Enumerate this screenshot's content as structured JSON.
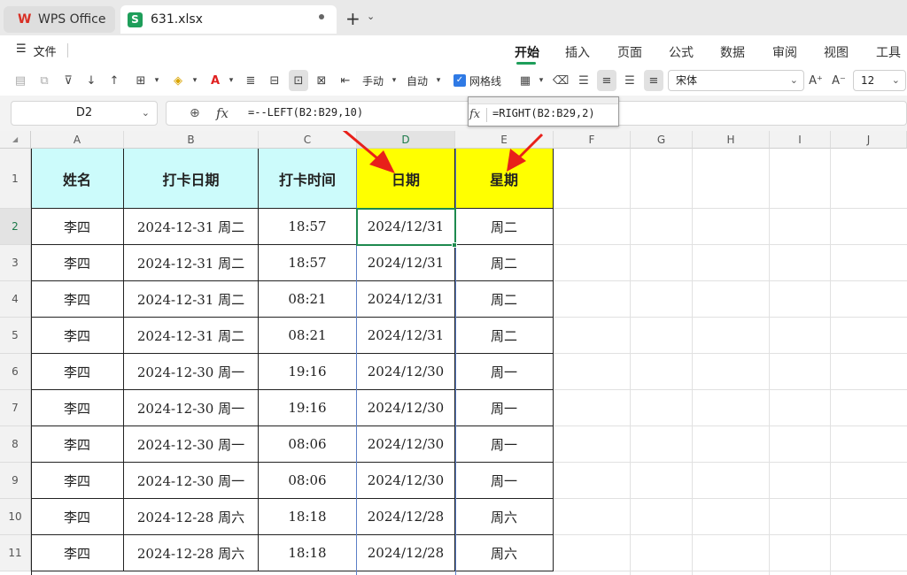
{
  "titlebar": {
    "app_tab": "WPS Office",
    "doc_tab": "631.xlsx",
    "doc_icon_letter": "S",
    "new_tab": "+",
    "new_tab_menu": "⌄"
  },
  "menu": {
    "file_icon": "☰",
    "file": "文件",
    "tabs": [
      "开始",
      "插入",
      "页面",
      "公式",
      "数据",
      "审阅",
      "视图",
      "工具"
    ],
    "active_tab": "开始"
  },
  "toolbar": {
    "manual": "手动",
    "auto": "自动",
    "gridlines": "网格线",
    "gridlines_checked": true,
    "font_name": "宋体",
    "font_size": "12",
    "increase_font": "A⁺",
    "decrease_font": "A⁻"
  },
  "formula_bar": {
    "name_box": "D2",
    "formula": "=--LEFT(B2:B29,10)",
    "fx": "fx"
  },
  "popup": {
    "fx": "fx",
    "formula": "=RIGHT(B2:B29,2)"
  },
  "grid": {
    "columns": [
      "A",
      "B",
      "C",
      "D",
      "E",
      "F",
      "G",
      "H",
      "I",
      "J"
    ],
    "selected_column": "D",
    "selected_row": "2",
    "row_numbers": [
      "1",
      "2",
      "3",
      "4",
      "5",
      "6",
      "7",
      "8",
      "9",
      "10",
      "11"
    ],
    "header_row": [
      "姓名",
      "打卡日期",
      "打卡时间",
      "日期",
      "星期"
    ],
    "rows": [
      [
        "李四",
        "2024-12-31 周二",
        "18:57",
        "2024/12/31",
        "周二"
      ],
      [
        "李四",
        "2024-12-31 周二",
        "18:57",
        "2024/12/31",
        "周二"
      ],
      [
        "李四",
        "2024-12-31 周二",
        "08:21",
        "2024/12/31",
        "周二"
      ],
      [
        "李四",
        "2024-12-31 周二",
        "08:21",
        "2024/12/31",
        "周二"
      ],
      [
        "李四",
        "2024-12-30 周一",
        "19:16",
        "2024/12/30",
        "周一"
      ],
      [
        "李四",
        "2024-12-30 周一",
        "19:16",
        "2024/12/30",
        "周一"
      ],
      [
        "李四",
        "2024-12-30 周一",
        "08:06",
        "2024/12/30",
        "周一"
      ],
      [
        "李四",
        "2024-12-30 周一",
        "08:06",
        "2024/12/30",
        "周一"
      ],
      [
        "李四",
        "2024-12-28 周六",
        "18:18",
        "2024/12/28",
        "周六"
      ],
      [
        "李四",
        "2024-12-28 周六",
        "18:18",
        "2024/12/28",
        "周六"
      ]
    ]
  },
  "colors": {
    "header_cyan": "#ccfbfb",
    "header_yellow": "#ffff00",
    "accent_green": "#1e9e5a",
    "arrow_red": "#e8201a"
  }
}
